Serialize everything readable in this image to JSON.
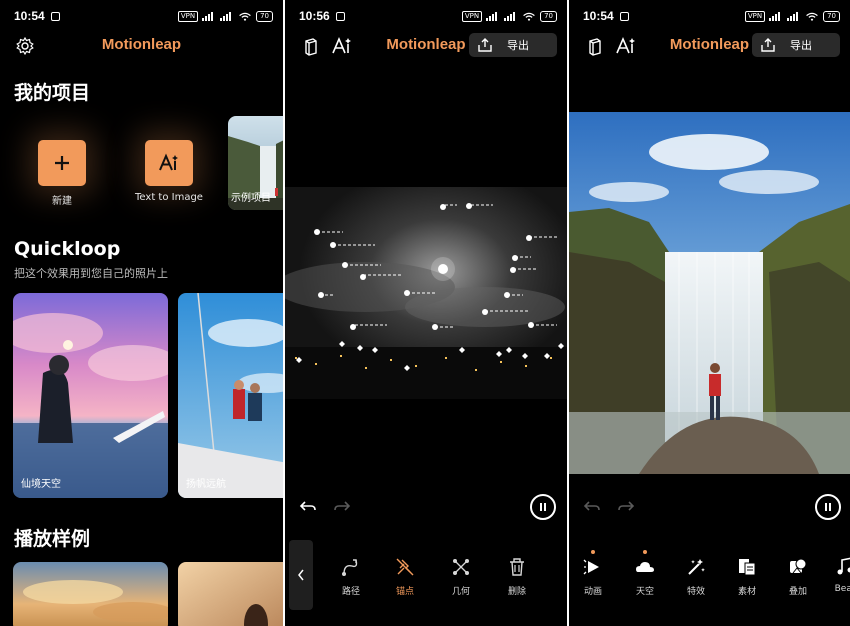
{
  "panel1": {
    "status_time": "10:54",
    "status_vpn": "VPN",
    "status_battery": "70",
    "brand": "Motionleap",
    "my_projects_title": "我的项目",
    "new_label": "新建",
    "text_to_image_label": "Text to Image",
    "example_project_label": "示例项目",
    "quickloop_title": "Quickloop",
    "quickloop_subtitle": "把这个效果用到您自己的照片上",
    "card1_label": "仙境天空",
    "card2_label": "扬帆远航",
    "showcase_title": "播放样例"
  },
  "panel2": {
    "status_time": "10:56",
    "status_vpn": "VPN",
    "status_battery": "70",
    "brand": "Motionleap",
    "export_label": "导出",
    "tools": [
      {
        "label": "路径",
        "icon": "path-icon"
      },
      {
        "label": "锚点",
        "icon": "anchor-icon"
      },
      {
        "label": "几何",
        "icon": "geometry-icon"
      },
      {
        "label": "删除",
        "icon": "trash-icon"
      }
    ]
  },
  "panel3": {
    "status_time": "10:54",
    "status_vpn": "VPN",
    "status_battery": "70",
    "brand": "Motionleap",
    "export_label": "导出",
    "tools": [
      {
        "label": "动画",
        "icon": "animate-icon"
      },
      {
        "label": "天空",
        "icon": "sky-icon"
      },
      {
        "label": "特效",
        "icon": "effects-icon"
      },
      {
        "label": "素材",
        "icon": "elements-icon"
      },
      {
        "label": "叠加",
        "icon": "overlay-icon"
      },
      {
        "label": "Beat",
        "icon": "music-icon"
      }
    ]
  },
  "colors": {
    "accent": "#f29a5b",
    "background": "#000000"
  }
}
